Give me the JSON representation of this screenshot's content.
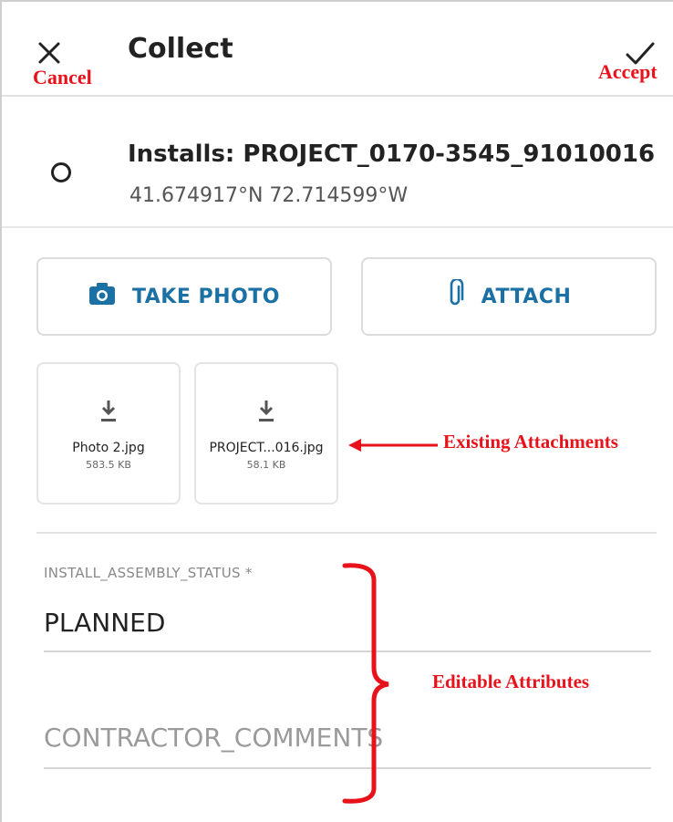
{
  "header": {
    "title": "Collect"
  },
  "annotations": {
    "cancel": "Cancel",
    "accept": "Accept",
    "existing_attachments": "Existing Attachments",
    "editable_attributes": "Editable Attributes",
    "color": "#e8121a"
  },
  "feature": {
    "title": "Installs: PROJECT_0170-3545_91010016",
    "coords": "41.674917°N 72.714599°W"
  },
  "buttons": {
    "take_photo": "TAKE PHOTO",
    "attach": "ATTACH",
    "accent": "#1b70a4"
  },
  "attachments": [
    {
      "name": "Photo 2.jpg",
      "size": "583.5 KB"
    },
    {
      "name": "PROJECT...016.jpg",
      "size": "58.1 KB"
    }
  ],
  "fields": {
    "status_label": "INSTALL_ASSEMBLY_STATUS *",
    "status_value": "PLANNED",
    "comments_placeholder": "CONTRACTOR_COMMENTS"
  },
  "icons": {
    "close": "close-icon",
    "accept": "check-icon",
    "feature": "circle-icon",
    "camera": "camera-icon",
    "paperclip": "paperclip-icon",
    "download": "download-icon"
  }
}
